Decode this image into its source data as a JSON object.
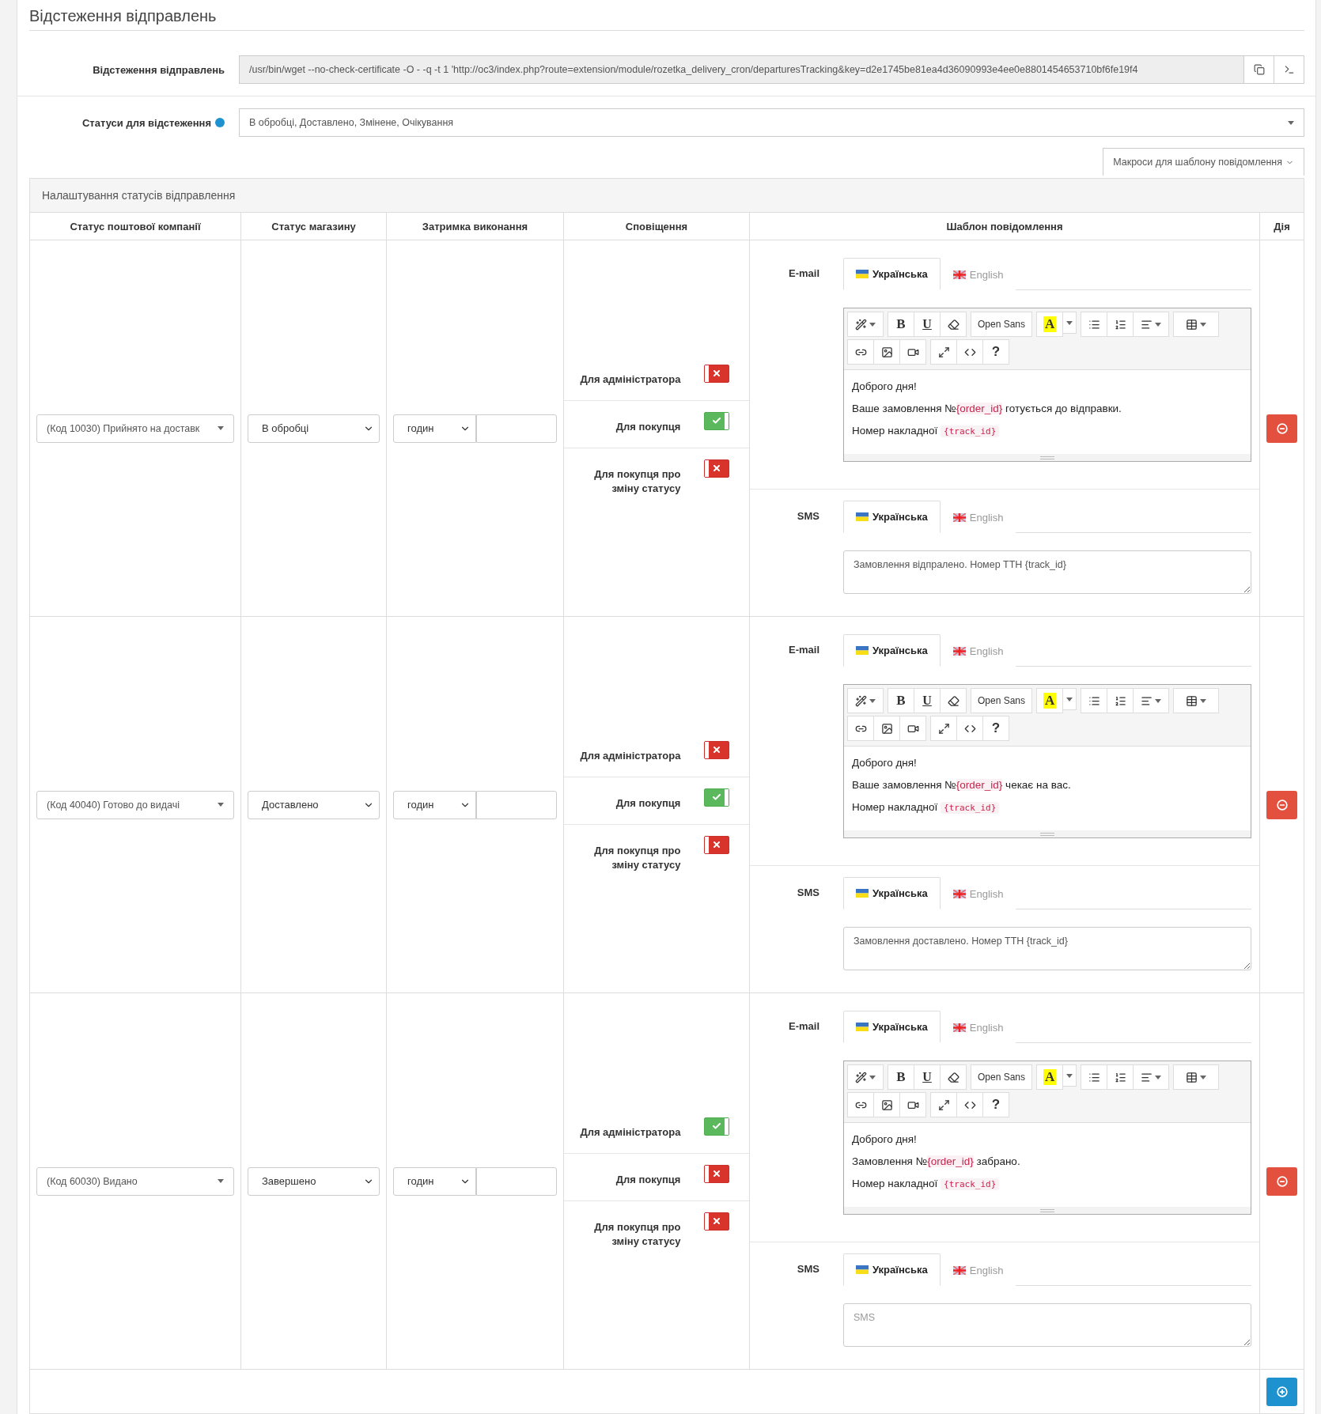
{
  "title": "Відстеження відправлень",
  "tracking": {
    "label": "Відстеження відправлень",
    "value": "/usr/bin/wget --no-check-certificate -O - -q -t 1 'http://oc3/index.php?route=extension/module/rozetka_delivery_cron/departuresTracking&key=d2e1745be81ea4d36090993e4ee0e8801454653710bf6fe19f4"
  },
  "statuses": {
    "label": "Статуси для відстеження",
    "value": "В обробці, Доставлено, Змінене, Очікування"
  },
  "macros_button": "Макроси для шаблону повідомлення",
  "panel_title": "Налаштування статусів відправлення",
  "columns": [
    "Статус поштової компанії",
    "Статус магазину",
    "Затримка виконання",
    "Сповіщення",
    "Шаблон повідомлення",
    "Дія"
  ],
  "rows": [
    {
      "company_status": "(Код 10030) Прийнято на доставк",
      "store_status": "В обробці",
      "delay_unit": "годин",
      "notifications": [
        {
          "label": "Для адміністратора",
          "on": false
        },
        {
          "label": "Для покупця",
          "on": true
        },
        {
          "label": "Для покупця про зміну статусу",
          "on": false
        }
      ],
      "email": {
        "label": "E-mail",
        "tabs": [
          {
            "kind": "ua",
            "label": "Українська",
            "selected": true
          },
          {
            "kind": "gb",
            "label": "English",
            "selected": false
          }
        ],
        "toolbar": [
          [
            [
              {
                "kind": "magic"
              }
            ],
            [
              {
                "kind": "bold",
                "label": "B"
              },
              {
                "kind": "underline",
                "label": "U"
              },
              {
                "kind": "eraser"
              }
            ],
            [
              {
                "kind": "font",
                "label": "Open Sans"
              }
            ],
            [
              {
                "kind": "color",
                "label": "A"
              },
              {
                "kind": "caret"
              }
            ],
            [
              {
                "kind": "ul"
              },
              {
                "kind": "ol"
              },
              {
                "kind": "align"
              }
            ],
            [
              {
                "kind": "table"
              }
            ]
          ],
          [
            [
              {
                "kind": "link"
              },
              {
                "kind": "image"
              },
              {
                "kind": "video"
              }
            ],
            [
              {
                "kind": "fullscreen"
              },
              {
                "kind": "code"
              },
              {
                "kind": "help",
                "label": "?"
              }
            ]
          ]
        ],
        "body": [
          [
            {
              "kind": "text",
              "text": "Доброго дня!"
            }
          ],
          [
            {
              "kind": "text",
              "text": "Ваше замовлення №"
            },
            {
              "kind": "macro",
              "text": "{order_id}"
            },
            {
              "kind": "text",
              "text": " готується до відправки."
            }
          ],
          [
            {
              "kind": "text",
              "text": "Номер накладної "
            },
            {
              "kind": "code",
              "text": "{track_id}"
            }
          ]
        ]
      },
      "sms": {
        "label": "SMS",
        "tabs": [
          {
            "kind": "ua",
            "label": "Українська",
            "selected": true
          },
          {
            "kind": "gb",
            "label": "English",
            "selected": false
          }
        ],
        "value": "Замовлення відпралено. Номер ТТН {track_id}"
      }
    },
    {
      "company_status": "(Код 40040) Готово до видачі",
      "store_status": "Доставлено",
      "delay_unit": "годин",
      "notifications": [
        {
          "label": "Для адміністратора",
          "on": false
        },
        {
          "label": "Для покупця",
          "on": true
        },
        {
          "label": "Для покупця про зміну статусу",
          "on": false
        }
      ],
      "email": {
        "label": "E-mail",
        "tabs": [
          {
            "kind": "ua",
            "label": "Українська",
            "selected": true
          },
          {
            "kind": "gb",
            "label": "English",
            "selected": false
          }
        ],
        "toolbar": [
          [
            [
              {
                "kind": "magic"
              }
            ],
            [
              {
                "kind": "bold",
                "label": "B"
              },
              {
                "kind": "underline",
                "label": "U"
              },
              {
                "kind": "eraser"
              }
            ],
            [
              {
                "kind": "font",
                "label": "Open Sans"
              }
            ],
            [
              {
                "kind": "color",
                "label": "A"
              },
              {
                "kind": "caret"
              }
            ],
            [
              {
                "kind": "ul"
              },
              {
                "kind": "ol"
              },
              {
                "kind": "align"
              }
            ],
            [
              {
                "kind": "table"
              }
            ]
          ],
          [
            [
              {
                "kind": "link"
              },
              {
                "kind": "image"
              },
              {
                "kind": "video"
              }
            ],
            [
              {
                "kind": "fullscreen"
              },
              {
                "kind": "code"
              },
              {
                "kind": "help",
                "label": "?"
              }
            ]
          ]
        ],
        "body": [
          [
            {
              "kind": "text",
              "text": "Доброго дня!"
            }
          ],
          [
            {
              "kind": "text",
              "text": "Ваше замовлення №"
            },
            {
              "kind": "macro",
              "text": "{order_id}"
            },
            {
              "kind": "text",
              "text": " чекає на вас."
            }
          ],
          [
            {
              "kind": "text",
              "text": "Номер накладної "
            },
            {
              "kind": "code",
              "text": "{track_id}"
            }
          ]
        ]
      },
      "sms": {
        "label": "SMS",
        "tabs": [
          {
            "kind": "ua",
            "label": "Українська",
            "selected": true
          },
          {
            "kind": "gb",
            "label": "English",
            "selected": false
          }
        ],
        "value": "Замовлення доставлено. Номер ТТН {track_id}"
      }
    },
    {
      "company_status": "(Код 60030) Видано",
      "store_status": "Завершено",
      "delay_unit": "годин",
      "notifications": [
        {
          "label": "Для адміністратора",
          "on": true
        },
        {
          "label": "Для покупця",
          "on": false
        },
        {
          "label": "Для покупця про зміну статусу",
          "on": false
        }
      ],
      "email": {
        "label": "E-mail",
        "tabs": [
          {
            "kind": "ua",
            "label": "Українська",
            "selected": true
          },
          {
            "kind": "gb",
            "label": "English",
            "selected": false
          }
        ],
        "toolbar": [
          [
            [
              {
                "kind": "magic"
              }
            ],
            [
              {
                "kind": "bold",
                "label": "B"
              },
              {
                "kind": "underline",
                "label": "U"
              },
              {
                "kind": "eraser"
              }
            ],
            [
              {
                "kind": "font",
                "label": "Open Sans"
              }
            ],
            [
              {
                "kind": "color",
                "label": "A"
              },
              {
                "kind": "caret"
              }
            ],
            [
              {
                "kind": "ul"
              },
              {
                "kind": "ol"
              },
              {
                "kind": "align"
              }
            ],
            [
              {
                "kind": "table"
              }
            ]
          ],
          [
            [
              {
                "kind": "link"
              },
              {
                "kind": "image"
              },
              {
                "kind": "video"
              }
            ],
            [
              {
                "kind": "fullscreen"
              },
              {
                "kind": "code"
              },
              {
                "kind": "help",
                "label": "?"
              }
            ]
          ]
        ],
        "body": [
          [
            {
              "kind": "text",
              "text": "Доброго дня!"
            }
          ],
          [
            {
              "kind": "text",
              "text": "Замовлення №"
            },
            {
              "kind": "macro",
              "text": "{order_id}"
            },
            {
              "kind": "text",
              "text": " забрано."
            }
          ],
          [
            {
              "kind": "text",
              "text": "Номер накладної "
            },
            {
              "kind": "code",
              "text": "{track_id}"
            }
          ]
        ]
      },
      "sms": {
        "label": "SMS",
        "tabs": [
          {
            "kind": "ua",
            "label": "Українська",
            "selected": true
          },
          {
            "kind": "gb",
            "label": "English",
            "selected": false
          }
        ],
        "placeholder": "SMS"
      }
    }
  ]
}
